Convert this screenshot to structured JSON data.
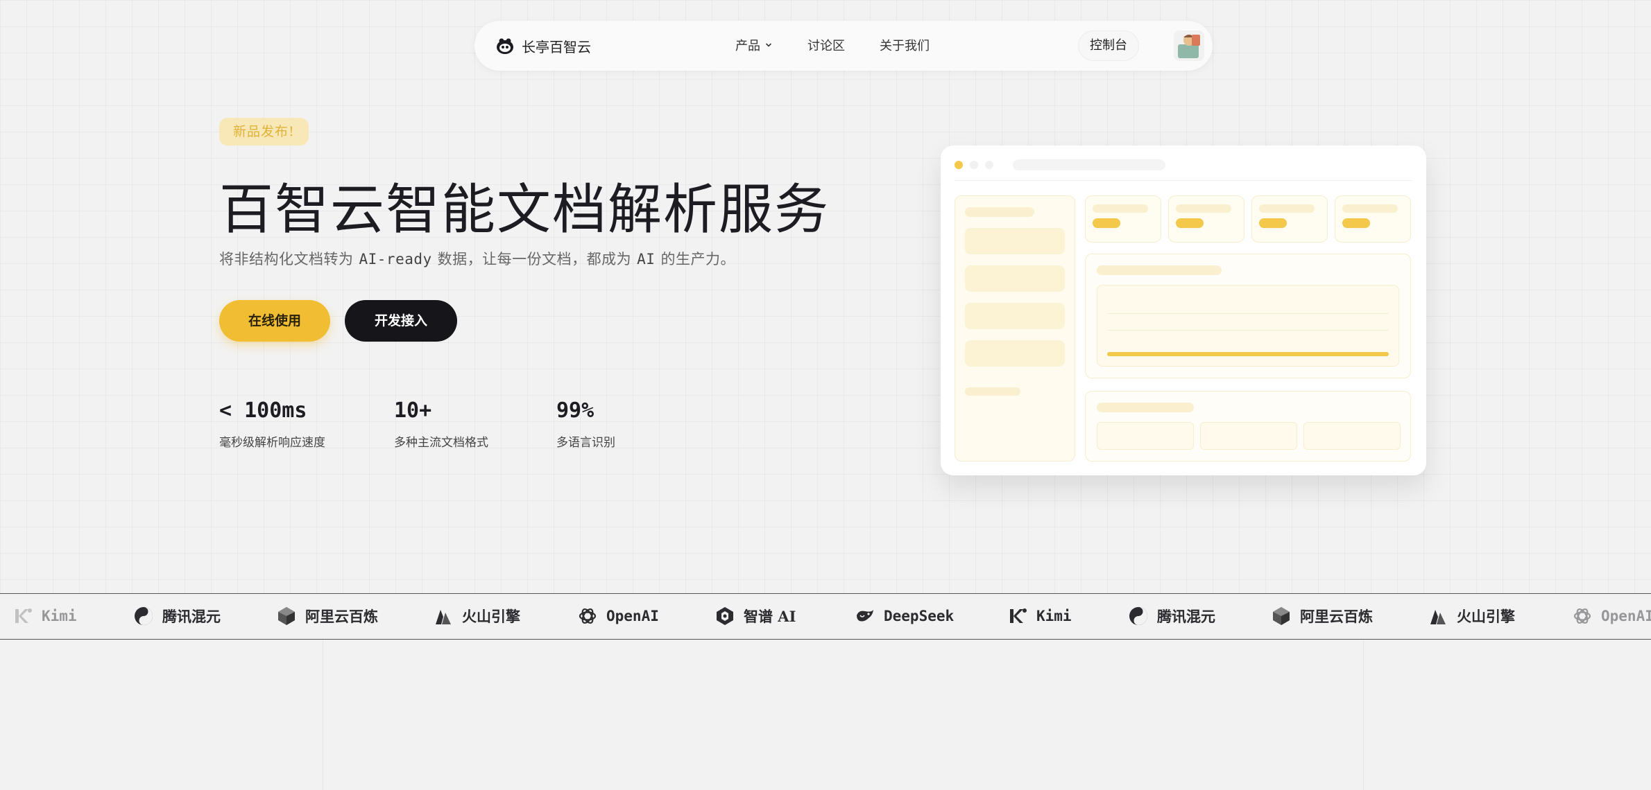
{
  "nav": {
    "brand": "长亭百智云",
    "links": {
      "products": "产品",
      "forum": "讨论区",
      "about": "关于我们"
    },
    "console": "控制台"
  },
  "hero": {
    "badge": "新品发布!",
    "title": "百智云智能文档解析服务",
    "subtitle_prefix": "将非结构化文档转为",
    "subtitle_code1": "AI-ready",
    "subtitle_mid": "数据，让每一份文档，都成为",
    "subtitle_code2": "AI",
    "subtitle_suffix": "的生产力。",
    "primary_button": "在线使用",
    "secondary_button": "开发接入",
    "stats": [
      {
        "value": "< 100ms",
        "label": "毫秒级解析响应速度"
      },
      {
        "value": "10+",
        "label": "多种主流文档格式"
      },
      {
        "value": "99%",
        "label": "多语言识别"
      }
    ]
  },
  "partners": [
    {
      "name": "Kimi",
      "icon": "kimi-logo-icon"
    },
    {
      "name": "腾讯混元",
      "icon": "tencent-hunyuan-logo-icon"
    },
    {
      "name": "阿里云百炼",
      "icon": "aliyun-bailian-logo-icon"
    },
    {
      "name": "火山引擎",
      "icon": "volcengine-logo-icon"
    },
    {
      "name": "OpenAI",
      "icon": "openai-logo-icon"
    },
    {
      "name": "智谱 AI",
      "icon": "zhipu-logo-icon"
    },
    {
      "name": "DeepSeek",
      "icon": "deepseek-logo-icon"
    }
  ],
  "colors": {
    "accent": "#f0bd33",
    "dark_button": "#15151a",
    "background": "#f2f2f2"
  }
}
